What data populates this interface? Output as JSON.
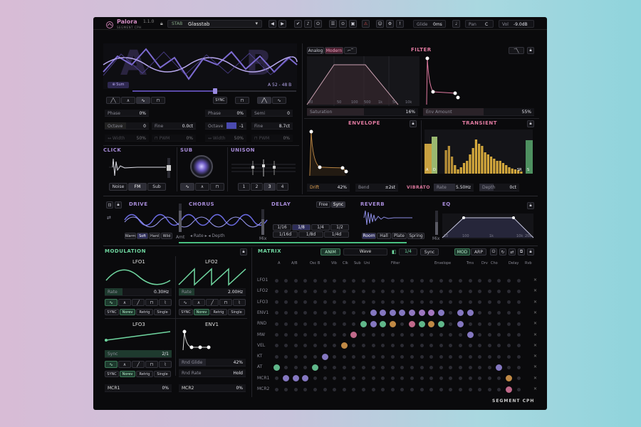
{
  "header": {
    "brand": "Palora",
    "version": "1.1.0",
    "maker": "SEGMENT CPH",
    "preset_tag": "STAB",
    "preset_name": "Glasstab",
    "glide_label": "Glide",
    "glide_value": "0ms",
    "pan_label": "Pan",
    "pan_value": "C",
    "vol_label": "Vol",
    "vol_value": "-9.0dB"
  },
  "osc": {
    "sum_label": "⊕ Sum",
    "ab_readout": "A 52 - 48 B",
    "sync_label": "SYNC",
    "a": {
      "phase_label": "Phase",
      "phase": "0%",
      "octave_label": "Octave",
      "octave": "0",
      "fine_label": "Fine",
      "fine": "0.0ct",
      "width_label": "↔ Width",
      "width": "50%",
      "pwm_label": "⊓ PWM",
      "pwm": "0%"
    },
    "b": {
      "phase_label": "Phase",
      "phase": "0%",
      "semi_label": "Semi",
      "semi": "0",
      "octave_label": "Octave",
      "octave": "-1",
      "fine_label": "Fine",
      "fine": "8.7ct",
      "width_label": "↔ Width",
      "width": "50%",
      "pwm_label": "⊓ PWM",
      "pwm": "0%"
    }
  },
  "click": {
    "title": "CLICK",
    "modes": [
      "Noise",
      "FM",
      "Sub"
    ],
    "active": "FM"
  },
  "sub": {
    "title": "SUB"
  },
  "unison": {
    "title": "UNISON",
    "voices": [
      "1",
      "2",
      "3",
      "4"
    ],
    "active": "3"
  },
  "filter": {
    "title": "FILTER",
    "modes": [
      "Analog",
      "Modern"
    ],
    "active": "Modern",
    "freqs": [
      "20",
      "50",
      "100",
      "500",
      "1k",
      "5k",
      "10k"
    ],
    "saturation_label": "Saturation",
    "saturation": "16%",
    "env_amount_label": "Env Amount",
    "env_amount": "55%"
  },
  "envelope": {
    "title": "ENVELOPE",
    "drift_label": "Drift",
    "drift": "42%",
    "bend_label": "Bend",
    "bend": "±2st"
  },
  "transient": {
    "title": "TRANSIENT",
    "marks": [
      "A",
      "D",
      "SR",
      "S"
    ],
    "bars": [
      0.55,
      0.65,
      0.4,
      0.2,
      0.1,
      0.15,
      0.25,
      0.3,
      0.45,
      0.6,
      0.8,
      0.7,
      0.65,
      0.5,
      0.45,
      0.4,
      0.35,
      0.3,
      0.3,
      0.25,
      0.2,
      0.15,
      0.12,
      0.1,
      0.08,
      0.05
    ]
  },
  "vibrato": {
    "title": "VIBRATO",
    "rate_label": "Rate",
    "rate": "5.50Hz",
    "depth_label": "Depth",
    "depth": "0ct"
  },
  "fx": {
    "drive": "DRIVE",
    "chorus": "CHORUS",
    "delay": "DELAY",
    "reverb": "REVERB",
    "eq": "EQ",
    "drive_modes": [
      "Warm",
      "Soft",
      "Hard",
      "Wild"
    ],
    "drive_active": "Soft",
    "amt": "Amt",
    "mix": "Mix",
    "chorus_hint": "◂ Rate ▸ ◂ Depth",
    "delay_modes": [
      "Free",
      "Sync"
    ],
    "delay_active": "Sync",
    "delay_r1": [
      "1/16",
      "1/8",
      "1/4",
      "1/2"
    ],
    "delay_r2": [
      "1/16d",
      "1/8d",
      "1/4d"
    ],
    "delay_active_div": "1/8",
    "reverb_modes": [
      "Room",
      "Hall",
      "Plate",
      "Spring"
    ],
    "reverb_active": "Room",
    "eq_freqs": [
      "20",
      "100",
      "1k",
      "10k",
      "20k"
    ]
  },
  "modulation": {
    "title": "MODULATION",
    "lfo1": {
      "title": "LFO1",
      "rate_label": "Rate",
      "rate": "0.30Hz"
    },
    "lfo2": {
      "title": "LFO2",
      "rate_label": "Rate",
      "rate": "2.00Hz"
    },
    "lfo3": {
      "title": "LFO3",
      "sync_label": "Sync",
      "sync": "2/1"
    },
    "env1": {
      "title": "ENV1",
      "glide_label": "Rnd Glide",
      "glide": "42%",
      "rate_label": "Rnd Rate",
      "rate": "Hold"
    },
    "modes": [
      "SYNC",
      "Norev",
      "Retrig",
      "Single"
    ],
    "active_mode": "Norev",
    "mcr1_label": "MCR1",
    "mcr1": "0%",
    "mcr2_label": "MCR2",
    "mcr2": "0%"
  },
  "matrix": {
    "title": "MATRIX",
    "anim": "ANIM",
    "wave": "Wave",
    "rate": "1/4",
    "sync": "Sync",
    "mod": "MOD",
    "arp": "ARP",
    "col_groups": [
      "A",
      "A/B",
      "Osc B",
      "Vib",
      "Clk",
      "Sub",
      "Uni",
      "Filter",
      "Envelope",
      "Trns",
      "Drv",
      "Cho",
      "Delay",
      "Rvb"
    ],
    "rows": [
      "LFO1",
      "LFO2",
      "LFO3",
      "ENV1",
      "RND",
      "MW",
      "VEL",
      "KT",
      "AT",
      "MCR1",
      "MCR2"
    ]
  },
  "footer": {
    "brand": "SEGMENT CPH"
  },
  "colors": {
    "accent_purple": "#a78bd8",
    "accent_pink": "#e07aa0",
    "accent_green": "#6fd6a0",
    "accent_orange": "#e0a050"
  }
}
